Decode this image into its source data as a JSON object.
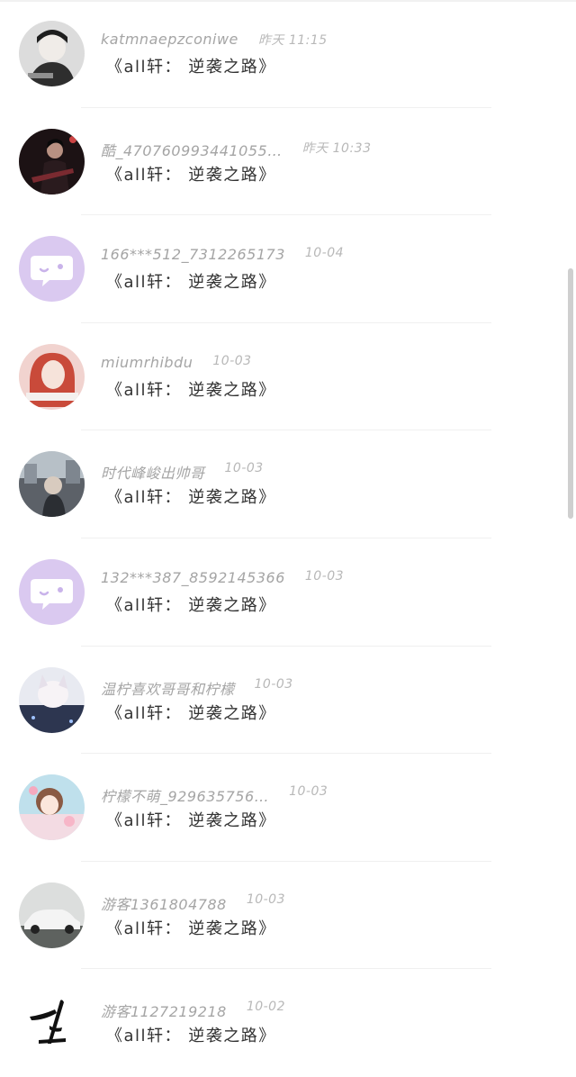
{
  "comments": [
    {
      "username": "katmnaepzconiwe",
      "time": "昨天 11:15",
      "content": "《all轩： 逆袭之路》",
      "avatar_icon": "person-photo-avatar",
      "avatar_colors": [
        "#d9d9d9",
        "#3a3a3a"
      ]
    },
    {
      "username": "酷_470760993441055…",
      "time": "昨天 10:33",
      "content": "《all轩： 逆袭之路》",
      "avatar_icon": "guitarist-photo-avatar",
      "avatar_colors": [
        "#1d1416",
        "#6b2a2f"
      ]
    },
    {
      "username": "166***512_7312265173",
      "time": "10-04",
      "content": "《all轩： 逆袭之路》",
      "avatar_icon": "default-chat-bubble-avatar",
      "avatar_colors": [
        "#d9c8ef",
        "#ffffff"
      ]
    },
    {
      "username": "miumrhibdu",
      "time": "10-03",
      "content": "《all轩： 逆袭之路》",
      "avatar_icon": "girl-photo-avatar",
      "avatar_colors": [
        "#f2d6d2",
        "#c94b3c"
      ]
    },
    {
      "username": "时代峰峻出帅哥",
      "time": "10-03",
      "content": "《all轩： 逆袭之路》",
      "avatar_icon": "street-photo-avatar",
      "avatar_colors": [
        "#b9c2c8",
        "#3c3f45"
      ]
    },
    {
      "username": "132***387_8592145366",
      "time": "10-03",
      "content": "《all轩： 逆袭之路》",
      "avatar_icon": "default-chat-bubble-avatar",
      "avatar_colors": [
        "#d9c8ef",
        "#ffffff"
      ]
    },
    {
      "username": "温柠喜欢哥哥和柠檬",
      "time": "10-03",
      "content": "《all轩： 逆袭之路》",
      "avatar_icon": "anime-night-avatar",
      "avatar_colors": [
        "#e6e8f0",
        "#2c3550"
      ]
    },
    {
      "username": "柠檬不萌_929635756…",
      "time": "10-03",
      "content": "《all轩： 逆袭之路》",
      "avatar_icon": "anime-girl-avatar",
      "avatar_colors": [
        "#f4e4e8",
        "#7fb5c9"
      ]
    },
    {
      "username": "游客1361804788",
      "time": "10-03",
      "content": "《all轩： 逆袭之路》",
      "avatar_icon": "white-car-avatar",
      "avatar_colors": [
        "#d7d9d8",
        "#5b5f5d"
      ]
    },
    {
      "username": "游客1127219218",
      "time": "10-02",
      "content": "《all轩： 逆袭之路》",
      "avatar_icon": "ink-character-avatar",
      "avatar_colors": [
        "#ffffff",
        "#111111"
      ]
    }
  ]
}
